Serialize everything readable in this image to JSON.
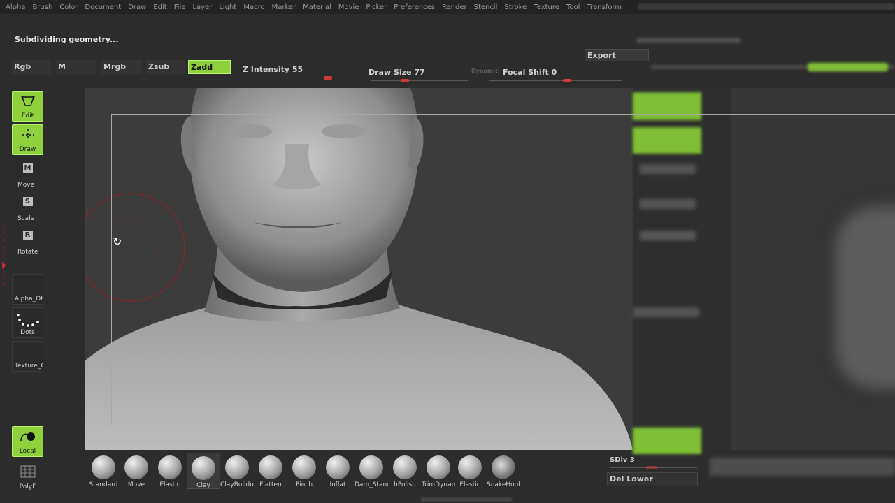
{
  "menu": [
    "Alpha",
    "Brush",
    "Color",
    "Document",
    "Draw",
    "Edit",
    "File",
    "Layer",
    "Light",
    "Macro",
    "Marker",
    "Material",
    "Movie",
    "Picker",
    "Preferences",
    "Render",
    "Stencil",
    "Stroke",
    "Texture",
    "Tool",
    "Transform"
  ],
  "status_text": "Subdividing geometry...",
  "export_label": "Export",
  "color_modes": {
    "rgb": "Rgb",
    "m": "M",
    "mrgb": "Mrgb",
    "zsub": "Zsub",
    "zadd": "Zadd"
  },
  "sliders": {
    "z_intensity": {
      "label": "Z Intensity",
      "value": "55"
    },
    "draw_size": {
      "label": "Draw Size",
      "value": "77"
    },
    "focal_shift": {
      "label": "Focal Shift",
      "value": "0"
    },
    "dynamic_label": "Dynamic"
  },
  "left_tools": {
    "edit": "Edit",
    "draw": "Draw",
    "move": "Move",
    "scale": "Scale",
    "rotate": "Rotate",
    "alpha": "Alpha_Off",
    "stroke": "Dots",
    "texture": "Texture_Off",
    "local": "Local",
    "polyf": "PolyF"
  },
  "brushes": [
    "Standard",
    "Move",
    "Elastic",
    "Clay",
    "ClayBuildup",
    "Flatten",
    "Pinch",
    "Inflat",
    "Dam_Standard",
    "hPolish",
    "TrimDynamic",
    "Elastic",
    "SnakeHook"
  ],
  "selected_brush": "Clay",
  "sdiv_label": "SDiv 3",
  "del_lower_label": "Del Lower",
  "accent_color": "#8ed13c",
  "slider_knob_color": "#d03a3a"
}
